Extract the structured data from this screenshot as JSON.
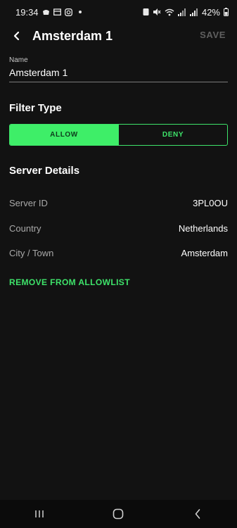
{
  "status_bar": {
    "time": "19:34",
    "battery_percent": "42%",
    "icons_left": [
      "notification-app-icon",
      "calendar-icon",
      "instagram-icon",
      "dot-icon"
    ],
    "icons_right": [
      "alarm-icon",
      "mute-icon",
      "wifi-icon",
      "signal-icon",
      "signal-icon",
      "battery-icon"
    ]
  },
  "app_bar": {
    "title": "Amsterdam 1",
    "save_label": "SAVE"
  },
  "name_field": {
    "label": "Name",
    "value": "Amsterdam 1"
  },
  "filter_type": {
    "title": "Filter Type",
    "options": [
      "ALLOW",
      "DENY"
    ],
    "selected": "ALLOW"
  },
  "server_details": {
    "title": "Server Details",
    "rows": [
      {
        "label": "Server ID",
        "value": "3PL0OU"
      },
      {
        "label": "Country",
        "value": "Netherlands"
      },
      {
        "label": "City / Town",
        "value": "Amsterdam"
      }
    ]
  },
  "remove_label": "REMOVE FROM ALLOWLIST",
  "colors": {
    "accent": "#3EEE68",
    "background": "#121212"
  },
  "nav_bar": {
    "buttons": [
      "recent-apps-icon",
      "home-icon",
      "back-icon"
    ]
  }
}
